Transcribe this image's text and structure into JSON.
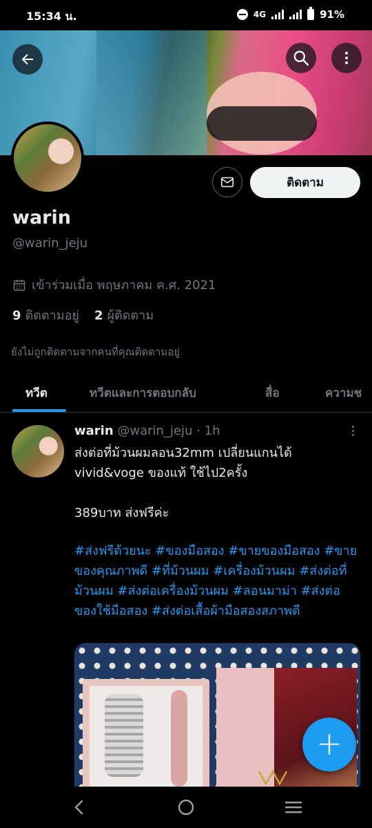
{
  "status_bar": {
    "time": "15:34 น.",
    "network": "4G",
    "battery": "91%"
  },
  "profile": {
    "display_name": "warin",
    "handle": "@warin_jeju",
    "joined": "เข้าร่วมเมื่อ พฤษภาคม ค.ศ. 2021",
    "following_count": "9",
    "following_label": "ติดตามอยู่",
    "followers_count": "2",
    "followers_label": "ผู้ติดตาม",
    "not_followed_note": "ยังไม่ถูกติดตามจากคนที่คุณติดตามอยู่",
    "follow_button": "ติดตาม"
  },
  "tabs": [
    {
      "label": "ทวีต",
      "active": true
    },
    {
      "label": "ทวีตและการตอบกลับ",
      "active": false
    },
    {
      "label": "สื่อ",
      "active": false
    },
    {
      "label": "ความช",
      "active": false
    }
  ],
  "tweet": {
    "author_name": "warin",
    "author_handle": "@warin_jeju",
    "time": "1h",
    "text": "ส่งต่อที่ม้วนผมลอน32mm เปลี่ยนแกนได้\nvivid&voge ของแท้ ใช้ไป2ครั้ง\n\n389บาท ส่งฟรีค่ะ",
    "hashtags": "#ส่งฟรีด้วยนะ #ของมือสอง #ขายของมือสอง #ขายของคุณภาพดี #ที่ม้วนผม #เครื่องม้วนผม #ส่งต่อที่ม้วนผม #ส่งต่อเครื่องม้วนผม #ลอนมาม่า #ส่งต่อของใช้มือสอง #ส่งต่อเสื้อผ้ามือสองสภาพดี"
  },
  "colors": {
    "accent": "#1d9bf0",
    "background": "#000000",
    "secondary_text": "#71767b",
    "primary_text": "#e7e9ea"
  },
  "icons": [
    "back-arrow-icon",
    "search-icon",
    "more-vertical-icon",
    "mail-icon",
    "calendar-icon",
    "plus-icon",
    "nav-back-icon",
    "nav-home-icon",
    "nav-recents-icon"
  ]
}
